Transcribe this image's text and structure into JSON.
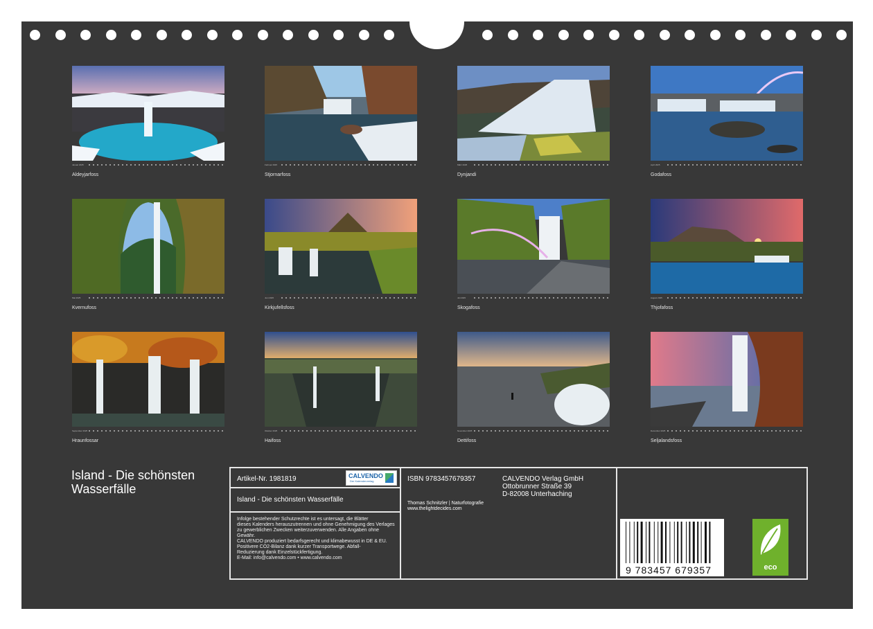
{
  "calendar": {
    "title": "Island - Die schönsten Wasserfälle"
  },
  "months": [
    {
      "caption": "Aldeyjarfoss",
      "strip_label": "Januar 2025"
    },
    {
      "caption": "Stjornarfoss",
      "strip_label": "Februar 2025"
    },
    {
      "caption": "Dynjandi",
      "strip_label": "März 2025"
    },
    {
      "caption": "Godafoss",
      "strip_label": "April 2025"
    },
    {
      "caption": "Kvernufoss",
      "strip_label": "Mai 2025"
    },
    {
      "caption": "Kirkjufellsfoss",
      "strip_label": "Juni 2025"
    },
    {
      "caption": "Skogafoss",
      "strip_label": "Juli 2025"
    },
    {
      "caption": "Thjofafoss",
      "strip_label": "August 2025"
    },
    {
      "caption": "Hraunfossar",
      "strip_label": "September 2025"
    },
    {
      "caption": "Haifoss",
      "strip_label": "Oktober 2025"
    },
    {
      "caption": "Dettifoss",
      "strip_label": "November 2025"
    },
    {
      "caption": "Seljalandsfoss",
      "strip_label": "Dezember 2025"
    }
  ],
  "info": {
    "article_no": "Artikel-Nr. 1981819",
    "logo_text": "CALVENDO",
    "logo_tagline": "Der Kalenderverlag",
    "box_title": "Island - Die schönsten Wasserfälle",
    "legal_lines": [
      "Infolge bestehender Schutzrechte ist es untersagt, die Blätter",
      "dieses Kalenders herauszutrennen und ohne Genehmigung des Verlages",
      "zu gewerblichen Zwecken weiterzuverwenden. Alle Angaben ohne",
      "Gewähr.",
      "CALVENDO produziert bedarfsgerecht und klimabewusst in DE & EU.",
      "Positivere CO2-Bilanz dank kurzer Transportwege. Abfall-",
      "Reduzierung dank Einzelstückfertigung.",
      "E-Mail: info@calvendo.com • www.calvendo.com"
    ],
    "isbn": "ISBN 9783457679357",
    "author": "Thomas Schnitzler | Naturfotografie",
    "website": "www.thelightdecides.com",
    "publisher_name": "CALVENDO Verlag GmbH",
    "publisher_street": "Ottobrunner Straße 39",
    "publisher_city": "D-82008 Unterhaching",
    "barcode_digits": "9 783457 679357",
    "eco_label": "eco"
  },
  "colors": {
    "board": "#383838",
    "text": "#ffffff",
    "eco_green": "#6fb12c",
    "logo_blue": "#1d64a8"
  }
}
